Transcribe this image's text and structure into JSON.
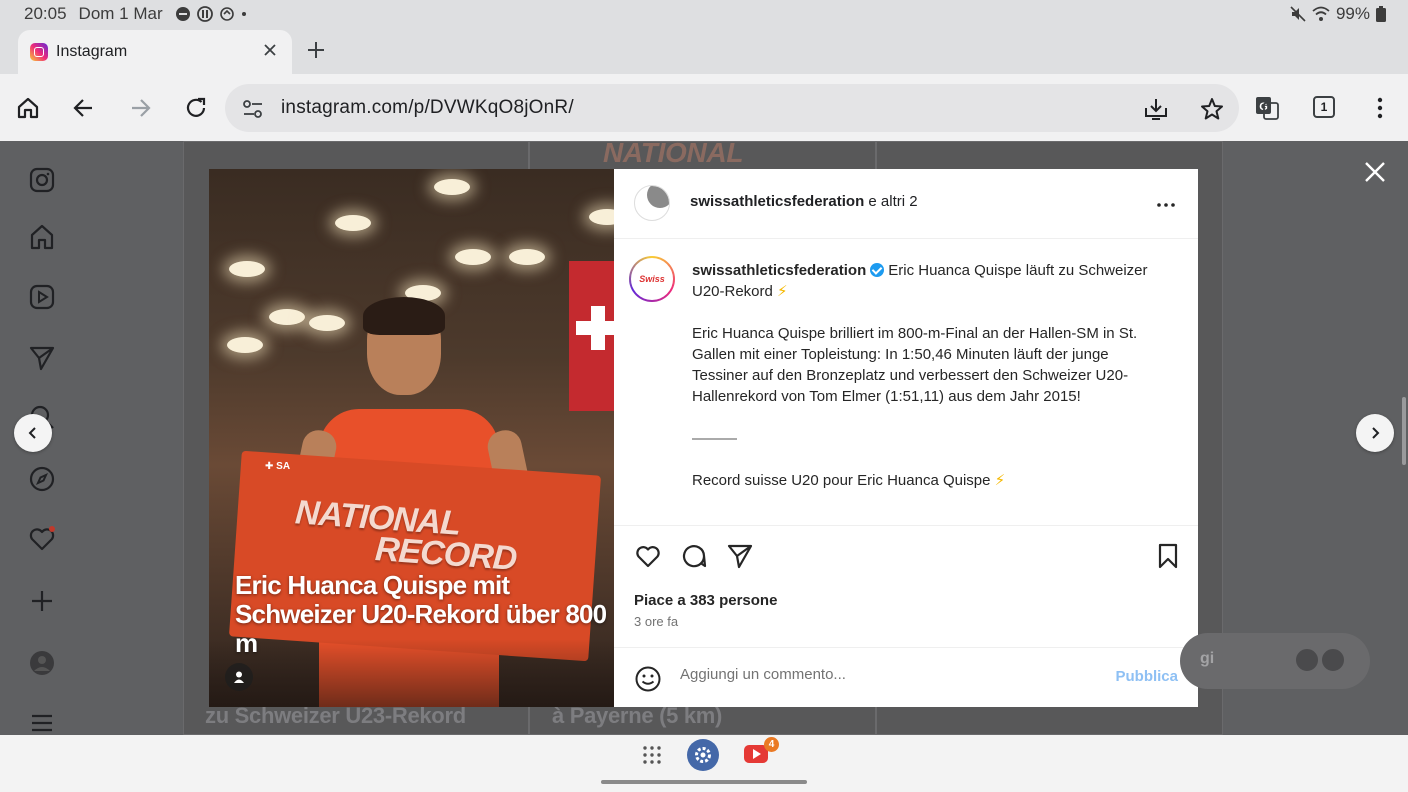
{
  "status_bar": {
    "time": "20:05",
    "date": "Dom 1 Mar",
    "battery": "99%",
    "icons": [
      "dnd-icon",
      "data-saver-icon",
      "sync-icon",
      "mute-icon",
      "wifi-icon",
      "battery-icon"
    ]
  },
  "browser": {
    "tab_title": "Instagram",
    "url": "instagram.com/p/DVWKqO8jOnR/",
    "tab_count": "1"
  },
  "post": {
    "header_user": "swissathleticsfederation",
    "header_suffix": " e altri 2",
    "caption_user": "swissathleticsfederation",
    "caption_title": "Eric Huanca Quispe läuft zu Schweizer U20-Rekord",
    "caption_body": "Eric Huanca Quispe brilliert im 800-m-Final an der Hallen-SM in St. Gallen mit einer Topleistung: In 1:50,46 Minuten läuft der junge Tessiner auf den Bronzeplatz und verbessert den Schweizer U20-Hallenrekord von Tom Elmer (1:51,11) aus dem Jahr 2015!",
    "separator": "———",
    "caption_fr": "Record suisse U20 pour Eric Huanca Quispe",
    "bolt": "⚡",
    "likes": "Piace a 383 persone",
    "time_ago": "3 ore fa",
    "comment_placeholder": "Aggiungi un commento...",
    "publish_label": "Pubblica",
    "image": {
      "sign_line1": "NATIONAL",
      "sign_line2": "RECORD",
      "overlay_text": "Eric Huanca Quispe mit Schweizer U20-Rekord über 800 m",
      "avatar_text": "Swiss"
    }
  },
  "background": {
    "tile_text_1": "zu Schweizer U23-Rekord",
    "tile_text_2": "à Payerne (5 km)",
    "tile_top_text": "NATIONAL",
    "messages_pill": "gi"
  },
  "taskbar": {
    "youtube_badge": "4"
  },
  "colors": {
    "publish": "#8ec0f4",
    "verified": "#1d9bf0",
    "settings_app": "#4468a8",
    "youtube": "#e53935"
  }
}
